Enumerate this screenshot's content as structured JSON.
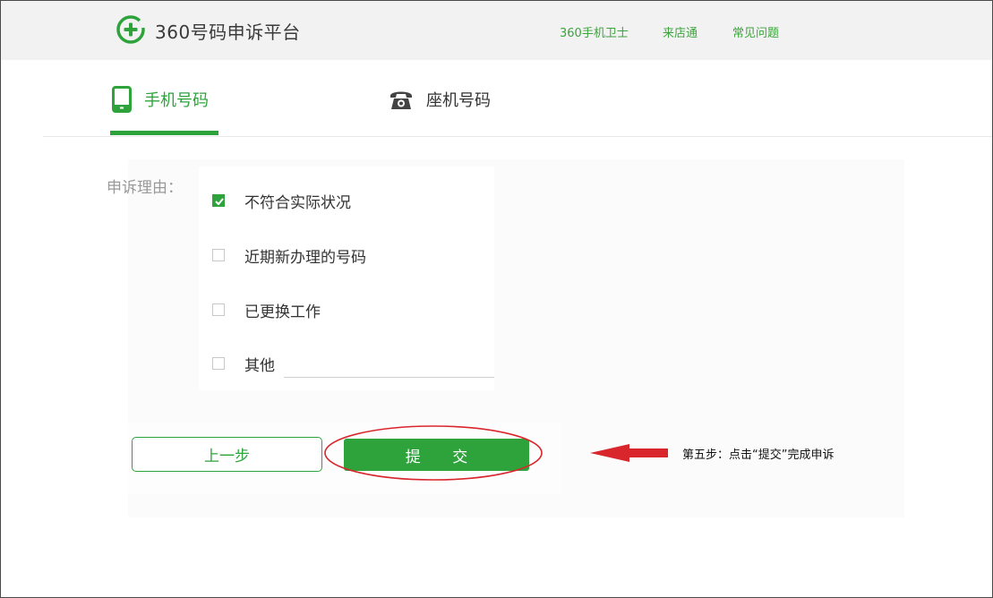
{
  "header": {
    "logo_text": "360号码申诉平台",
    "nav": [
      "360手机卫士",
      "来店通",
      "常见问题"
    ]
  },
  "tabs": [
    {
      "label": "手机号码",
      "icon": "mobile-phone-icon",
      "active": true
    },
    {
      "label": "座机号码",
      "icon": "telephone-icon",
      "active": false
    }
  ],
  "form": {
    "reason_label": "申诉理由：",
    "options": [
      {
        "label": "不符合实际状况",
        "checked": true
      },
      {
        "label": "近期新办理的号码",
        "checked": false
      },
      {
        "label": "已更换工作",
        "checked": false
      },
      {
        "label": "其他",
        "checked": false
      }
    ],
    "other_value": ""
  },
  "buttons": {
    "prev": "上一步",
    "submit": "提 交"
  },
  "annotation": {
    "text": "第五步：点击“提交”完成申诉"
  },
  "colors": {
    "brand_green": "#2ea33c",
    "annotation_red": "#d9262c"
  }
}
